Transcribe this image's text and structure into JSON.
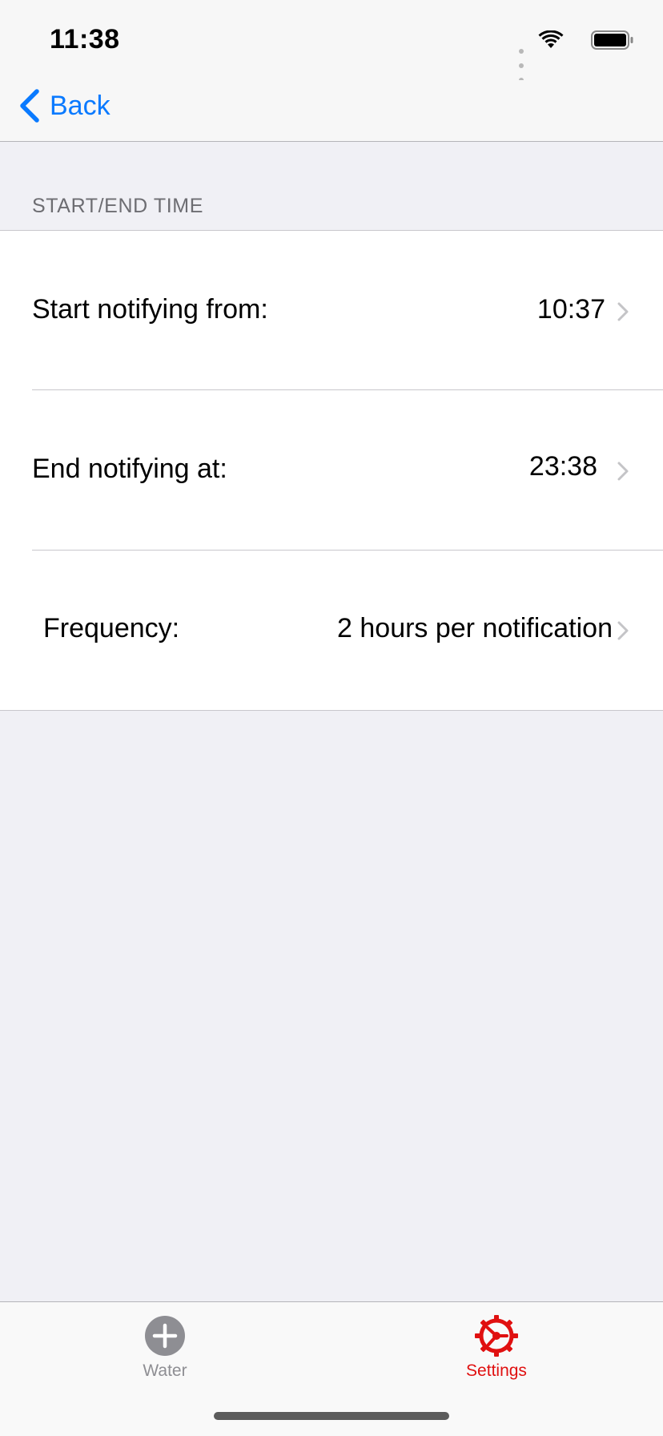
{
  "status_bar": {
    "time": "11:38"
  },
  "nav": {
    "back_label": "Back"
  },
  "section": {
    "header": "START/END TIME"
  },
  "rows": [
    {
      "title": "Start notifying from:",
      "value": "10:37"
    },
    {
      "title": "End notifying at:",
      "value": "23:38"
    },
    {
      "title": "Frequency:",
      "value": "2 hours per notification"
    }
  ],
  "tabs": [
    {
      "label": "Water",
      "icon": "plus-circle-icon",
      "selected": false
    },
    {
      "label": "Settings",
      "icon": "gear-icon",
      "selected": true
    }
  ],
  "colors": {
    "accent": "#0a7aff",
    "selected_tab": "#e01010",
    "unselected_tab": "#8e8e93",
    "background": "#f0f0f5"
  }
}
